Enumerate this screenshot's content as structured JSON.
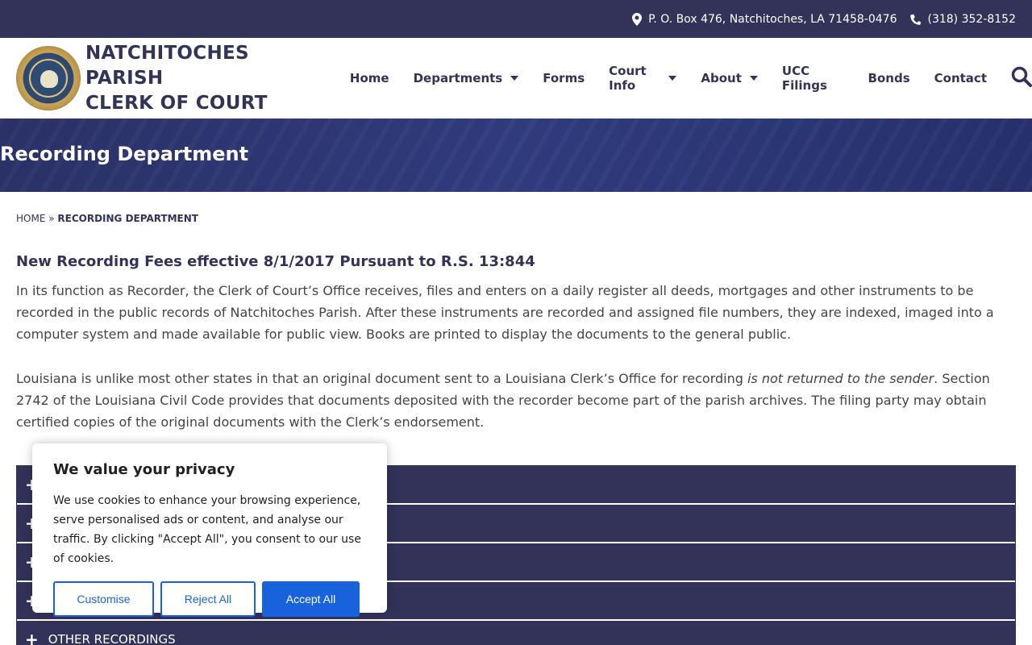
{
  "topbar": {
    "address": "P. O. Box 476, Natchitoches, LA 71458-0476",
    "phone": "(318) 352-8152"
  },
  "site": {
    "title_line1": "NATCHITOCHES PARISH",
    "title_line2": "CLERK OF COURT"
  },
  "nav": {
    "items": [
      {
        "label": "Home",
        "dropdown": false
      },
      {
        "label": "Departments",
        "dropdown": true
      },
      {
        "label": "Forms",
        "dropdown": false
      },
      {
        "label": "Court Info",
        "dropdown": true
      },
      {
        "label": "About",
        "dropdown": true
      },
      {
        "label": "UCC Filings",
        "dropdown": false
      },
      {
        "label": "Bonds",
        "dropdown": false
      },
      {
        "label": "Contact",
        "dropdown": false
      }
    ]
  },
  "hero": {
    "title": "Recording Department"
  },
  "breadcrumb": {
    "home": "HOME",
    "separator": "»",
    "current": "RECORDING DEPARTMENT"
  },
  "main": {
    "heading": "New Recording Fees effective 8/1/2017 Pursuant to R.S. 13:844",
    "para1": "In its function as Recorder, the Clerk of Court’s Office receives, files and enters on a daily register all deeds, mortgages and other instruments to be recorded in the public records of Natchitoches Parish. After these instruments are recorded and assigned file numbers, they are indexed, imaged into a computer system and made available for public view. Books are printed to display the documents to the general public.",
    "para2_before": "Louisiana is unlike most other states in that an original document sent to a Louisiana Clerk’s Office for recording ",
    "para2_em": "is not returned to the sender",
    "para2_after": ". Section 2742 of the Louisiana Civil Code provides that documents deposited with the recorder become part of the parish archives. The filing party may obtain certified copies of the original documents with the Clerk’s endorsement.",
    "accordion": [
      {
        "label": ""
      },
      {
        "label": ""
      },
      {
        "label": ""
      },
      {
        "label": ""
      },
      {
        "label": "OTHER RECORDINGS"
      }
    ]
  },
  "cookie": {
    "title": "We value your privacy",
    "text": "We use cookies to enhance your browsing experience, serve personalised ads or content, and analyse our traffic. By clicking \"Accept All\", you consent to our use of cookies.",
    "customise": "Customise",
    "reject": "Reject All",
    "accept": "Accept All"
  },
  "colors": {
    "navy": "#33335a",
    "hero": "#2a3166",
    "accent_blue": "#1863dc"
  }
}
